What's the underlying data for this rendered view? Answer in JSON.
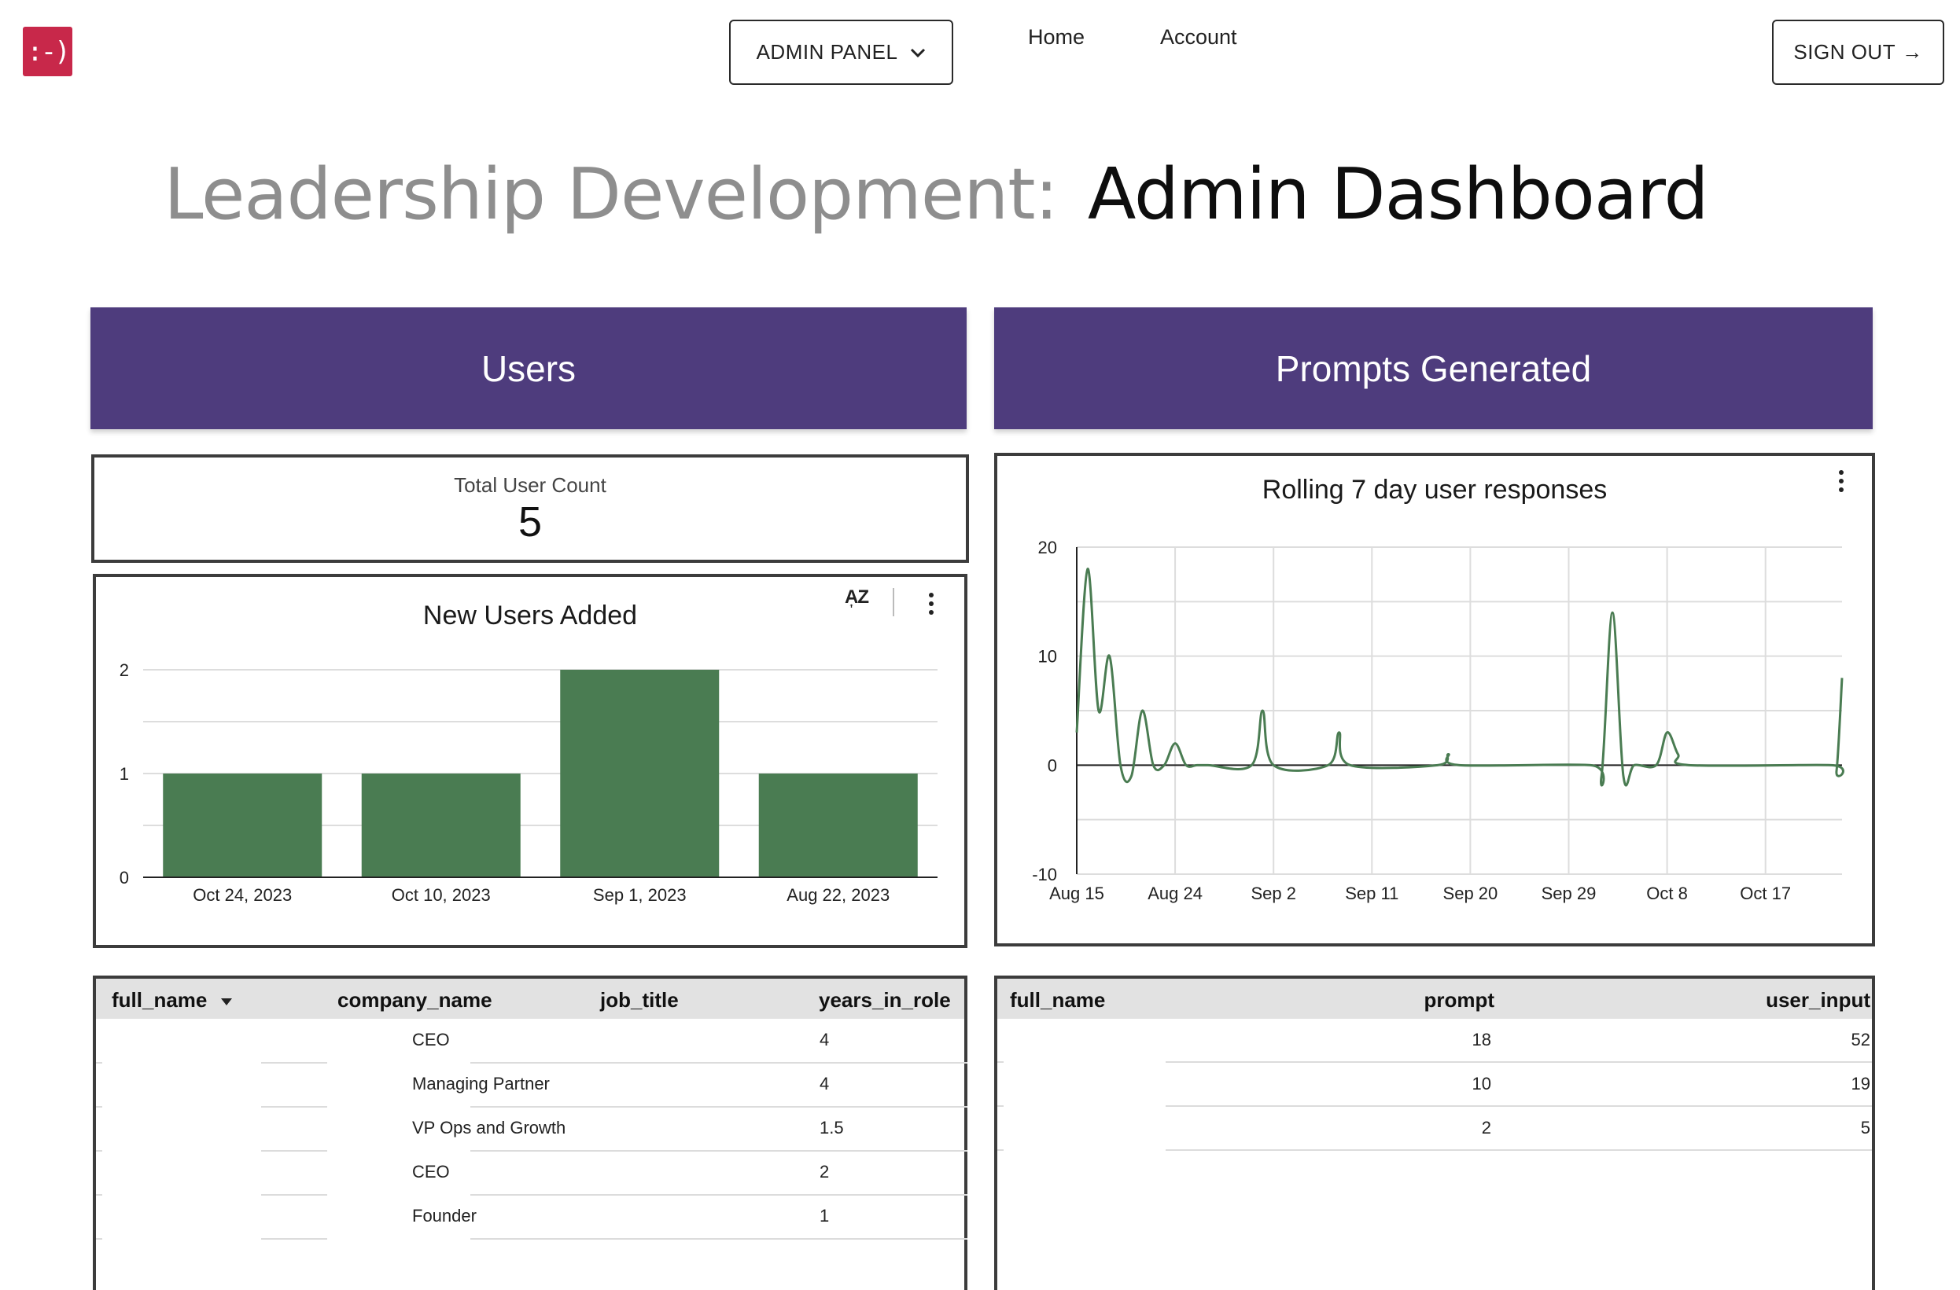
{
  "nav": {
    "logo_text": ":-)",
    "admin_label": "ADMIN PANEL",
    "links": [
      "Home",
      "Account"
    ],
    "signout_label": "SIGN OUT",
    "signout_arrow": "→"
  },
  "title": {
    "prefix": "Leadership Development:",
    "main": "Admin Dashboard"
  },
  "sections": {
    "users": "Users",
    "prompts": "Prompts Generated"
  },
  "scorecard": {
    "label": "Total User Count",
    "value": "5"
  },
  "colors": {
    "accent_purple": "#4e3c7d",
    "logo_red": "#c8284a",
    "series_green": "#4a7c52"
  },
  "chart_data": [
    {
      "type": "bar",
      "title": "New Users Added",
      "categories": [
        "Oct 24, 2023",
        "Oct 10, 2023",
        "Sep 1, 2023",
        "Aug 22, 2023"
      ],
      "values": [
        1,
        1,
        2,
        1
      ],
      "ylim": [
        0,
        2
      ],
      "yticks": [
        0,
        1,
        2
      ],
      "grid": true,
      "legend": "none"
    },
    {
      "type": "line",
      "title": "Rolling 7 day user responses",
      "x_labels": [
        "Aug 15",
        "Aug 24",
        "Sep 2",
        "Sep 11",
        "Sep 20",
        "Sep 29",
        "Oct 8",
        "Oct 17"
      ],
      "x_day_range": [
        0,
        70
      ],
      "ylim": [
        -10,
        20
      ],
      "yticks": [
        -10,
        0,
        10,
        20
      ],
      "grid": true,
      "legend": "none",
      "series": [
        {
          "points": [
            [
              0,
              3
            ],
            [
              1,
              18
            ],
            [
              2,
              5
            ],
            [
              3,
              10
            ],
            [
              4,
              0
            ],
            [
              5,
              -1
            ],
            [
              6,
              5
            ],
            [
              7,
              0
            ],
            [
              8,
              0
            ],
            [
              9,
              2
            ],
            [
              10,
              0
            ],
            [
              11,
              0
            ],
            [
              12,
              0
            ],
            [
              16,
              0
            ],
            [
              17,
              5
            ],
            [
              18,
              0
            ],
            [
              23,
              0
            ],
            [
              24,
              3
            ],
            [
              25,
              0
            ],
            [
              33,
              0
            ],
            [
              34,
              1
            ],
            [
              35,
              0
            ],
            [
              47,
              0
            ],
            [
              48,
              -1
            ],
            [
              49,
              14
            ],
            [
              50,
              -1
            ],
            [
              51,
              0
            ],
            [
              53,
              0
            ],
            [
              54,
              3
            ],
            [
              55,
              1
            ],
            [
              56,
              0
            ],
            [
              69,
              0
            ],
            [
              69.5,
              -0.5
            ],
            [
              70,
              8
            ]
          ]
        }
      ]
    }
  ],
  "users_table": {
    "columns": [
      "full_name",
      "company_name",
      "job_title",
      "years_in_role"
    ],
    "rows": [
      {
        "job_title": "CEO",
        "years_in_role": "4"
      },
      {
        "job_title": "Managing Partner",
        "years_in_role": "4"
      },
      {
        "job_title": "VP Ops and Growth",
        "years_in_role": "1.5"
      },
      {
        "job_title": "CEO",
        "years_in_role": "2"
      },
      {
        "job_title": "Founder",
        "years_in_role": "1"
      }
    ]
  },
  "prompts_table": {
    "columns": [
      "full_name",
      "prompt",
      "user_input"
    ],
    "rows": [
      {
        "prompt": "18",
        "user_input": "52"
      },
      {
        "prompt": "10",
        "user_input": "19"
      },
      {
        "prompt": "2",
        "user_input": "5"
      }
    ]
  }
}
